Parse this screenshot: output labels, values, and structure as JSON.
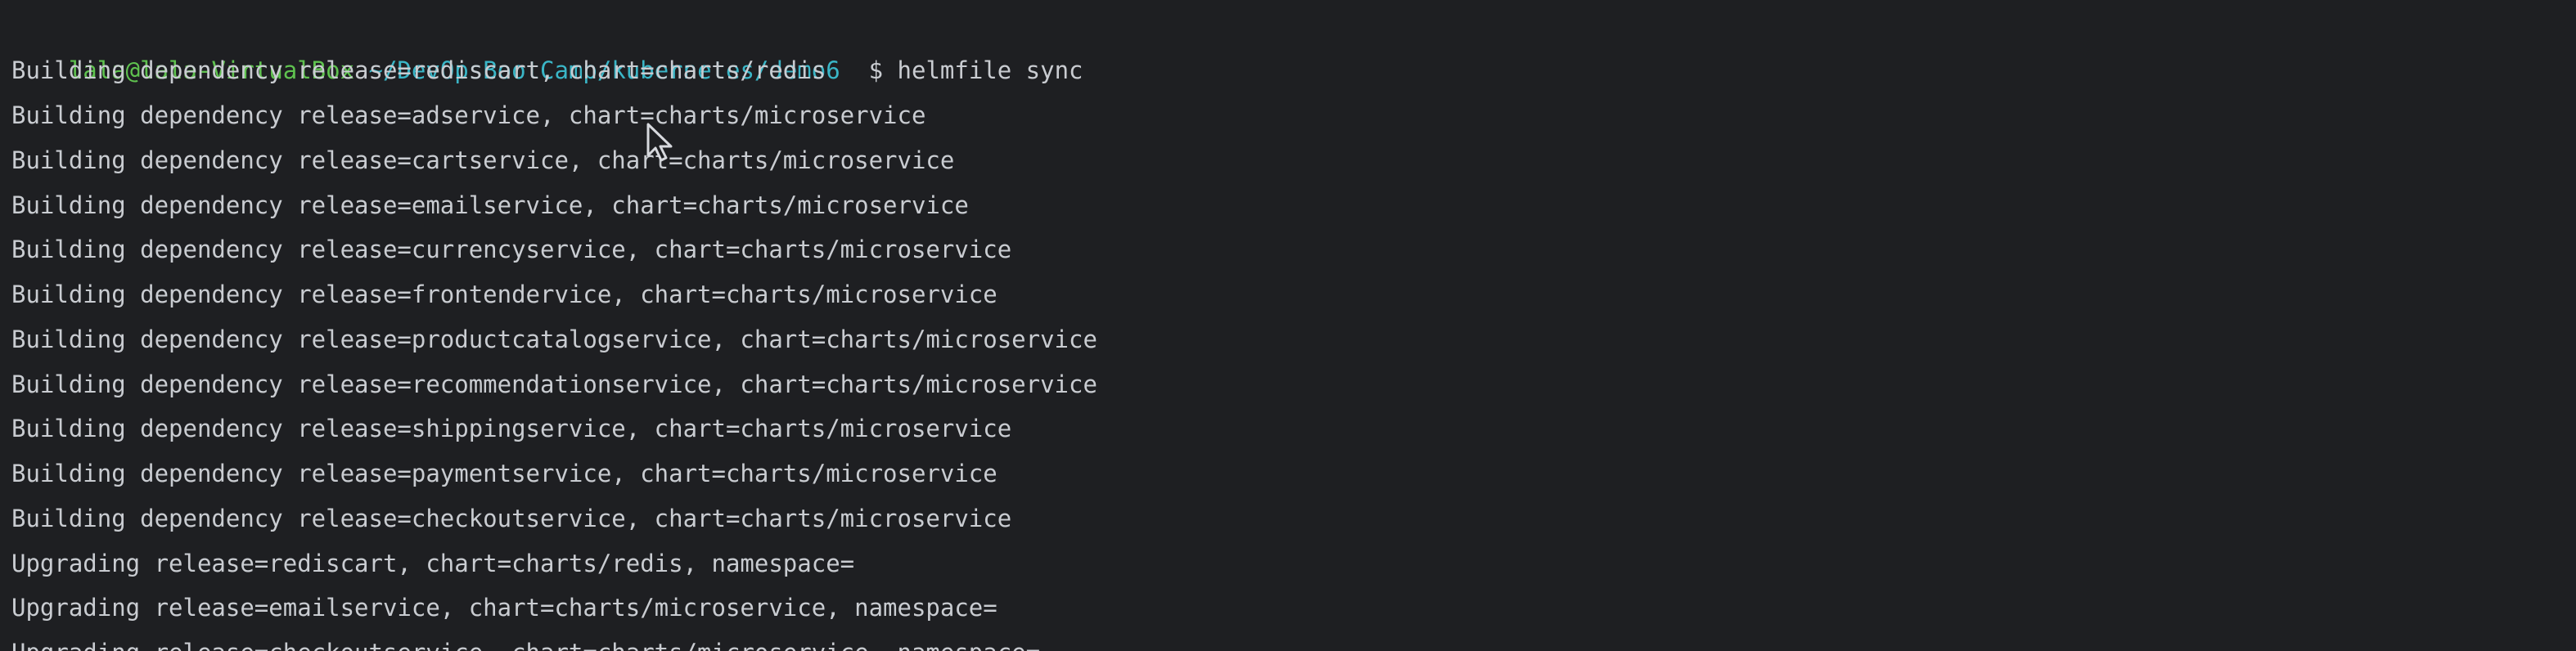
{
  "prompt": {
    "user_host": "lala@lala-VirtualBox",
    "path": "~/DevOpsBootCamp/kubernetes/demo6",
    "symbol": "$",
    "command": "helmfile sync"
  },
  "output_lines": [
    "Building dependency release=rediscart, chart=charts/redis",
    "Building dependency release=adservice, chart=charts/microservice",
    "Building dependency release=cartservice, chart=charts/microservice",
    "Building dependency release=emailservice, chart=charts/microservice",
    "Building dependency release=currencyservice, chart=charts/microservice",
    "Building dependency release=frontendervice, chart=charts/microservice",
    "Building dependency release=productcatalogservice, chart=charts/microservice",
    "Building dependency release=recommendationservice, chart=charts/microservice",
    "Building dependency release=shippingservice, chart=charts/microservice",
    "Building dependency release=paymentservice, chart=charts/microservice",
    "Building dependency release=checkoutservice, chart=charts/microservice",
    "Upgrading release=rediscart, chart=charts/redis, namespace=",
    "Upgrading release=emailservice, chart=charts/microservice, namespace=",
    "Upgrading release=checkoutservice, chart=charts/microservice, namespace="
  ],
  "icons": {
    "mouse_cursor": "mouse-pointer-icon"
  },
  "colors": {
    "background": "#1e1f22",
    "text": "#c9ccd1",
    "user_host": "#5fc24f",
    "path": "#3ab6c7"
  }
}
